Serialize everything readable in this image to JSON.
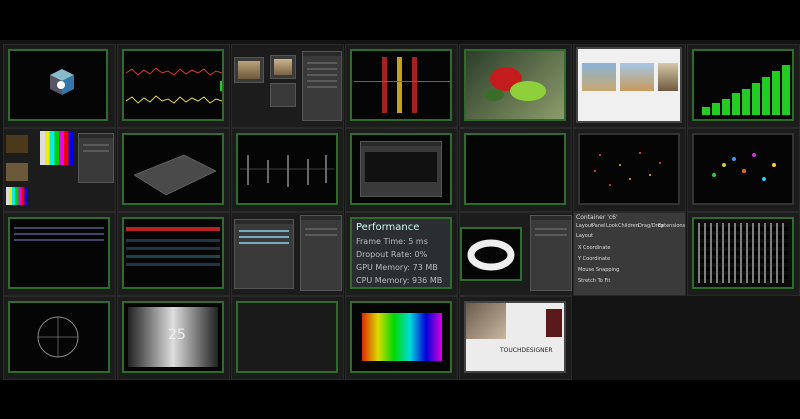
{
  "performance_panel": {
    "title": "Performance",
    "lines": [
      "Frame Time: 5 ms",
      "Dropout Rate: 0%",
      "GPU Memory: 73 MB",
      "CPU Memory: 936 MB"
    ]
  },
  "parameter_panel": {
    "title": "Container 'c6'",
    "tabs": [
      "Layout",
      "Panel",
      "Look",
      "Children",
      "Drag/Drop",
      "Extensions",
      "Common"
    ],
    "section": "Layout",
    "rows": [
      "X Coordinate",
      "Y Coordinate",
      "Mouse Snapping",
      "Stretch To Fit"
    ]
  },
  "gradient_label": "25",
  "gallery_footer_text": "TOUCHDESIGNER",
  "colors": {
    "background": "#000000",
    "canvas": "#141414",
    "frame_green": "#2f6b2f",
    "bar_green": "#22cc22",
    "red_wave": "#dd3333",
    "yellow_wave": "#e6d84a"
  }
}
